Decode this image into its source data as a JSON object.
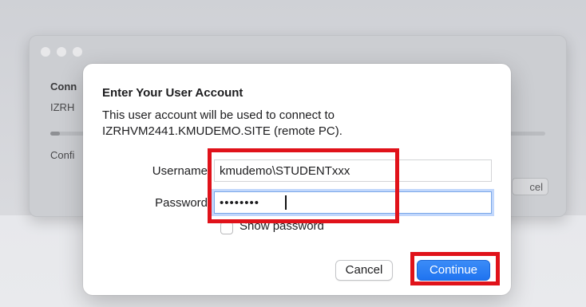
{
  "background_window": {
    "title": "Conn",
    "host": "IZRH",
    "status": "Confi",
    "cancel_label": "cel",
    "progress": 0.02
  },
  "dialog": {
    "title": "Enter Your User Account",
    "message_line1": "This user account will be used to connect to",
    "message_line2": "IZRHVM2441.KMUDEMO.SITE (remote PC).",
    "username_label": "Username",
    "username_value": "kmudemo\\STUDENTxxx",
    "password_label": "Password",
    "password_value": "••••••••",
    "show_password_label": "Show password",
    "show_password_checked": false,
    "cancel_label": "Cancel",
    "continue_label": "Continue"
  },
  "colors": {
    "accent": "#1f73f0",
    "highlight": "#e0121a"
  }
}
